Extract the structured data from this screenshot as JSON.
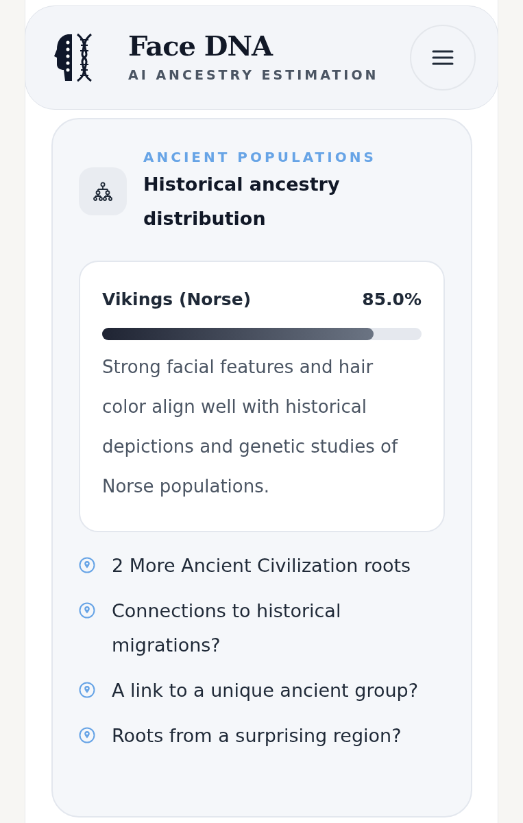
{
  "header": {
    "title": "Face DNA",
    "subtitle": "AI ANCESTRY ESTIMATION"
  },
  "section": {
    "eyebrow": "ANCIENT POPULATIONS",
    "title": "Historical ancestry distribution"
  },
  "results": [
    {
      "name": "Vikings (Norse)",
      "percent": "85.0%",
      "level": 0.85,
      "description": "Strong facial features and hair color align well with historical depictions and genetic studies of Norse populations."
    }
  ],
  "teasers": [
    "2 More Ancient Civilization roots",
    "Connections to historical migrations?",
    "A link to a unique ancient group?",
    "Roots from a surprising region?"
  ]
}
